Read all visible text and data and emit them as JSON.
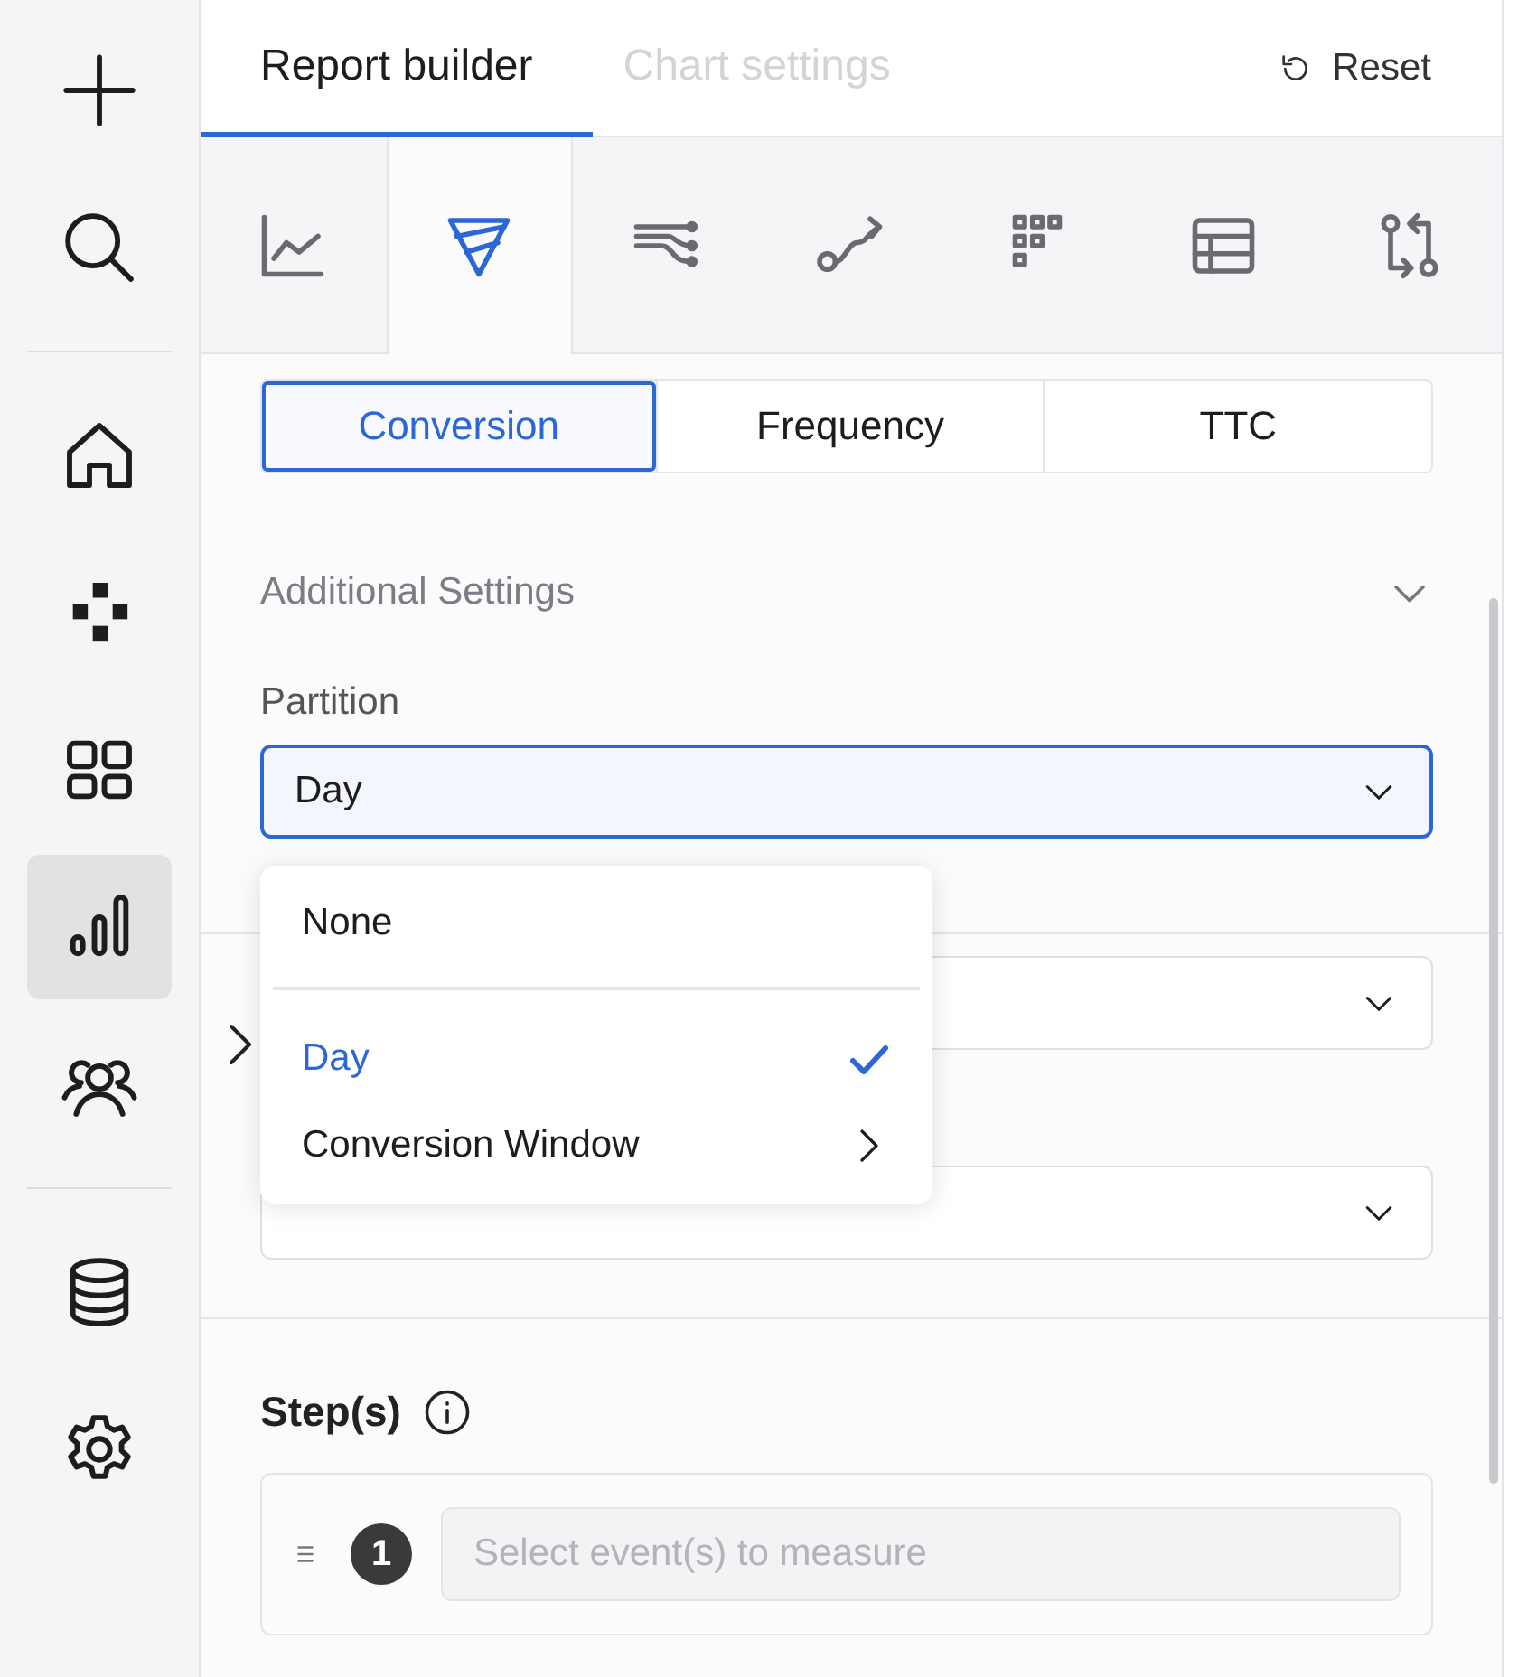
{
  "sidebar": {
    "groups": [
      {
        "items": [
          {
            "kind": "plus",
            "selected": false
          },
          {
            "kind": "search",
            "selected": false
          }
        ]
      },
      {
        "items": [
          {
            "kind": "home",
            "selected": false
          },
          {
            "kind": "blocks",
            "selected": false
          },
          {
            "kind": "grid",
            "selected": false
          },
          {
            "kind": "bars",
            "selected": true
          },
          {
            "kind": "people",
            "selected": false
          }
        ]
      },
      {
        "items": [
          {
            "kind": "database",
            "selected": false
          },
          {
            "kind": "settings",
            "selected": false
          }
        ]
      }
    ]
  },
  "tabs": [
    {
      "label": "Report builder",
      "selected": true,
      "disabled": false
    },
    {
      "label": "Chart settings",
      "selected": false,
      "disabled": true
    }
  ],
  "reset_button": {
    "label": "Reset"
  },
  "chart_types": [
    {
      "kind": "line",
      "selected": false
    },
    {
      "kind": "funnel",
      "selected": true
    },
    {
      "kind": "flows",
      "selected": false
    },
    {
      "kind": "path",
      "selected": false
    },
    {
      "kind": "retention",
      "selected": false
    },
    {
      "kind": "table",
      "selected": false
    },
    {
      "kind": "compare",
      "selected": false
    }
  ],
  "segments": [
    {
      "label": "Conversion",
      "selected": true
    },
    {
      "label": "Frequency",
      "selected": false
    },
    {
      "label": "TTC",
      "selected": false
    }
  ],
  "additional_settings": {
    "title": "Additional Settings"
  },
  "partition": {
    "label": "Partition",
    "value": "Day",
    "focused": true
  },
  "partition_menu": {
    "items": [
      {
        "label": "None",
        "selected": false,
        "submenu": false
      },
      {
        "label": "Day",
        "selected": true,
        "submenu": false
      },
      {
        "label": "Conversion Window",
        "selected": false,
        "submenu": true
      }
    ]
  },
  "steps": {
    "title": "Step(s)",
    "items": [
      {
        "number": "1",
        "placeholder": "Select event(s) to measure"
      }
    ]
  }
}
